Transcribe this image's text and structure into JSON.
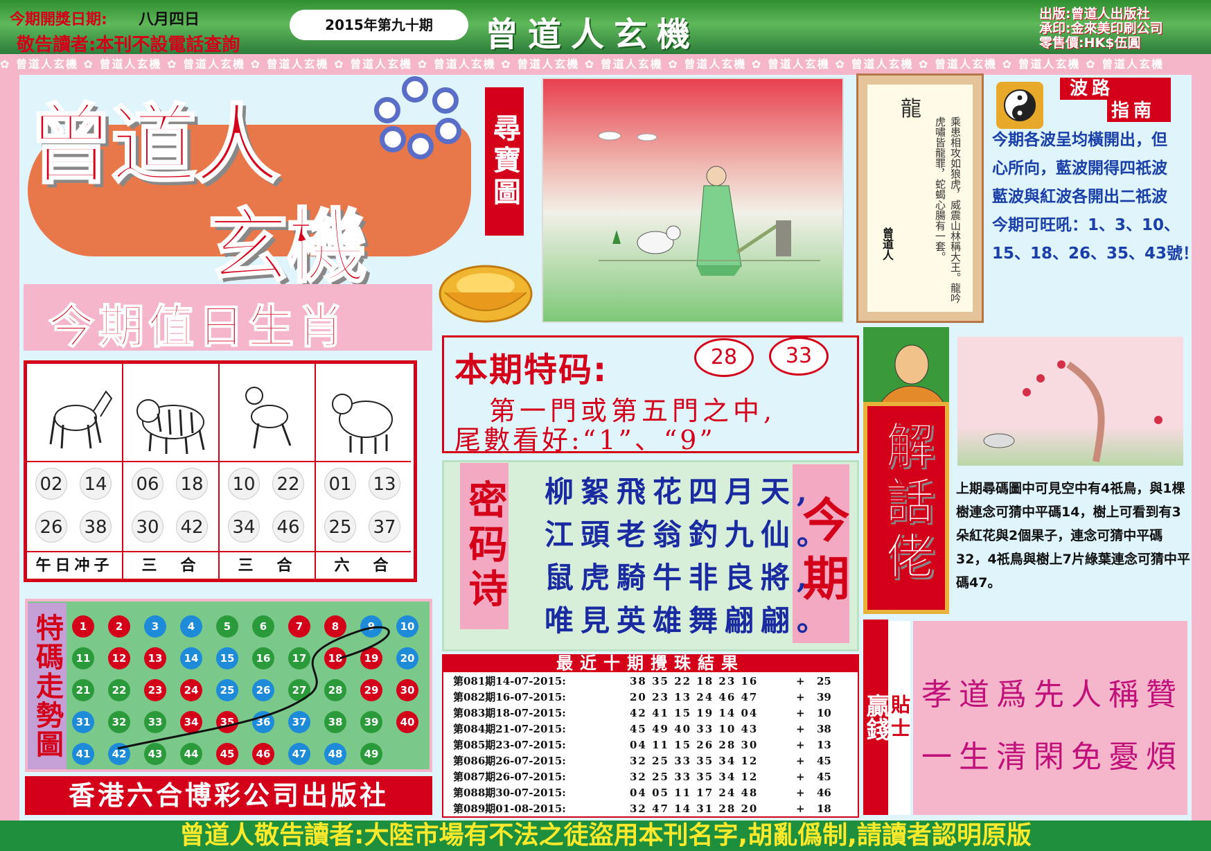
{
  "header": {
    "date_label": "今期開獎日期:",
    "date_value": "八月四日",
    "notice": "敬告讀者:本刊不設電話查詢",
    "issue": "2015年第九十期",
    "masthead": "曾道人玄機",
    "publisher_lines": [
      "出版:曾道人出版社",
      "承印:金來美印刷公司",
      "零售價:HK$伍圓"
    ],
    "pattern_text": "曾道人玄機"
  },
  "logo": {
    "main": "曾道人",
    "sub": "玄機",
    "treasure_label": "尋寶圖"
  },
  "poem_scroll": {
    "title": "龍",
    "text": "乘患相攻如狼虎，威震山林稱大王。龍吟虎嘯皆龍罪，蛇蝎心腸有一套。",
    "signature": "曾道人"
  },
  "wave_guide": {
    "title_line1": "波路",
    "title_line2": "指南",
    "lines": [
      "今期各波呈均橫開出，但",
      "心所向，藍波開得四祇波",
      "藍波與紅波各開出二祇波",
      "今期可旺吼：1、3、10、",
      "15、18、26、35、43號！"
    ]
  },
  "zodiac": {
    "title": "今期值日生肖",
    "columns": [
      {
        "animal": "horse",
        "numbers": [
          "02",
          "14",
          "26",
          "38"
        ],
        "footer": "午日冲子"
      },
      {
        "animal": "tiger",
        "numbers": [
          "06",
          "18",
          "30",
          "42"
        ],
        "footer": "三　合"
      },
      {
        "animal": "dog",
        "numbers": [
          "10",
          "22",
          "34",
          "46"
        ],
        "footer": "三　合"
      },
      {
        "animal": "sheep",
        "numbers": [
          "01",
          "13",
          "25",
          "37"
        ],
        "footer": "六　合"
      }
    ]
  },
  "trend": {
    "label": "特碼走勢圖",
    "balls": [
      {
        "n": "1",
        "c": "#d4001a"
      },
      {
        "n": "2",
        "c": "#d4001a"
      },
      {
        "n": "3",
        "c": "#1d8bd8"
      },
      {
        "n": "4",
        "c": "#1d8bd8"
      },
      {
        "n": "5",
        "c": "#2a9a3a"
      },
      {
        "n": "6",
        "c": "#2a9a3a"
      },
      {
        "n": "7",
        "c": "#d4001a"
      },
      {
        "n": "8",
        "c": "#d4001a"
      },
      {
        "n": "9",
        "c": "#1d8bd8"
      },
      {
        "n": "10",
        "c": "#1d8bd8"
      },
      {
        "n": "11",
        "c": "#2a9a3a"
      },
      {
        "n": "12",
        "c": "#d4001a"
      },
      {
        "n": "13",
        "c": "#d4001a"
      },
      {
        "n": "14",
        "c": "#1d8bd8"
      },
      {
        "n": "15",
        "c": "#1d8bd8"
      },
      {
        "n": "16",
        "c": "#2a9a3a"
      },
      {
        "n": "17",
        "c": "#2a9a3a"
      },
      {
        "n": "18",
        "c": "#d4001a"
      },
      {
        "n": "19",
        "c": "#d4001a"
      },
      {
        "n": "20",
        "c": "#1d8bd8"
      },
      {
        "n": "21",
        "c": "#2a9a3a"
      },
      {
        "n": "22",
        "c": "#2a9a3a"
      },
      {
        "n": "23",
        "c": "#d4001a"
      },
      {
        "n": "24",
        "c": "#d4001a"
      },
      {
        "n": "25",
        "c": "#1d8bd8"
      },
      {
        "n": "26",
        "c": "#1d8bd8"
      },
      {
        "n": "27",
        "c": "#2a9a3a"
      },
      {
        "n": "28",
        "c": "#2a9a3a"
      },
      {
        "n": "29",
        "c": "#d4001a"
      },
      {
        "n": "30",
        "c": "#d4001a"
      },
      {
        "n": "31",
        "c": "#1d8bd8"
      },
      {
        "n": "32",
        "c": "#2a9a3a"
      },
      {
        "n": "33",
        "c": "#2a9a3a"
      },
      {
        "n": "34",
        "c": "#d4001a"
      },
      {
        "n": "35",
        "c": "#d4001a"
      },
      {
        "n": "36",
        "c": "#1d8bd8"
      },
      {
        "n": "37",
        "c": "#1d8bd8"
      },
      {
        "n": "38",
        "c": "#2a9a3a"
      },
      {
        "n": "39",
        "c": "#2a9a3a"
      },
      {
        "n": "40",
        "c": "#d4001a"
      },
      {
        "n": "41",
        "c": "#1d8bd8"
      },
      {
        "n": "42",
        "c": "#1d8bd8"
      },
      {
        "n": "43",
        "c": "#2a9a3a"
      },
      {
        "n": "44",
        "c": "#2a9a3a"
      },
      {
        "n": "45",
        "c": "#d4001a"
      },
      {
        "n": "46",
        "c": "#d4001a"
      },
      {
        "n": "47",
        "c": "#1d8bd8"
      },
      {
        "n": "48",
        "c": "#1d8bd8"
      },
      {
        "n": "49",
        "c": "#2a9a3a"
      }
    ]
  },
  "publisher_bar": "香港六合博彩公司出版社",
  "special": {
    "title": "本期特码:",
    "codes": [
      "28",
      "33"
    ],
    "line1": "第一門或第五門之中,",
    "line2": "尾數看好:“1”、“9”"
  },
  "mima": {
    "label": "密码诗",
    "jin_label": "今期",
    "lines": [
      "柳絮飛花四月天,",
      "江頭老翁釣九仙。",
      "鼠虎騎牛非良將,",
      "唯見英雄舞翩翩。"
    ]
  },
  "results": {
    "title": "最近十期攪珠結果",
    "rows": [
      {
        "issue": "第081期14-07-2015:",
        "nums": "38 35 22 18 23 16",
        "sp": "25"
      },
      {
        "issue": "第082期16-07-2015:",
        "nums": "20 23 13 24 46 47",
        "sp": "39"
      },
      {
        "issue": "第083期18-07-2015:",
        "nums": "42 41 15 19 14 04",
        "sp": "10"
      },
      {
        "issue": "第084期21-07-2015:",
        "nums": "45 49 40 33 10 43",
        "sp": "38"
      },
      {
        "issue": "第085期23-07-2015:",
        "nums": "04 11 15 26 28 30",
        "sp": "13"
      },
      {
        "issue": "第086期26-07-2015:",
        "nums": "32 25 33 35 34 12",
        "sp": "45"
      },
      {
        "issue": "第087期26-07-2015:",
        "nums": "32 25 33 35 34 12",
        "sp": "45"
      },
      {
        "issue": "第088期30-07-2015:",
        "nums": "04 05 11 17 24 48",
        "sp": "46"
      },
      {
        "issue": "第089期01-08-2015:",
        "nums": "32 47 14 31 28 20",
        "sp": "18"
      }
    ]
  },
  "explainer": {
    "label": "解話佬",
    "text": "上期尋碼圖中可見空中有4祇鳥，與1棵樹連念可猜中平碼14，樹上可看到有3朵紅花與2個果子，連念可猜中平碼32，4祇鳥與樹上7片綠葉連念可猜中平碼47。"
  },
  "tip": {
    "label1": "贏錢",
    "label2": "貼士",
    "lines": [
      "孝道爲先人稱贊",
      "一生清閑免憂煩"
    ]
  },
  "footer": "曾道人敬告讀者:大陸市場有不法之徒盜用本刊名字,胡亂僞制,請讀者認明原版"
}
